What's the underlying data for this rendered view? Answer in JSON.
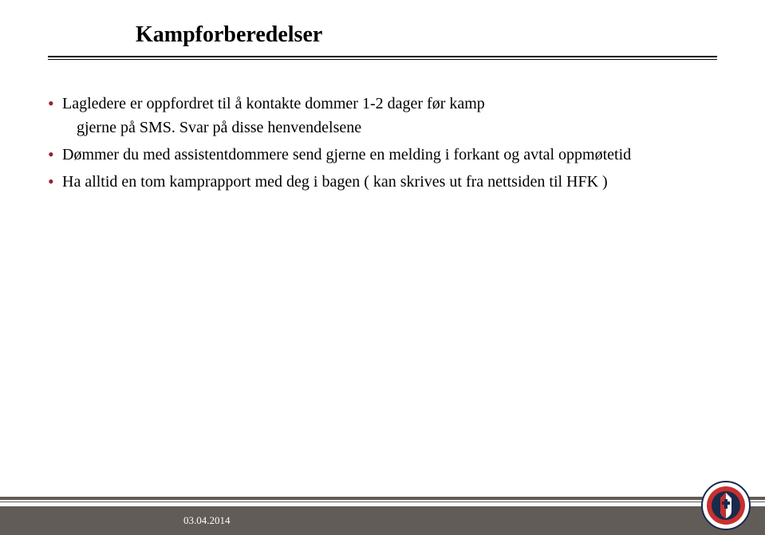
{
  "title": "Kampforberedelser",
  "bullets": [
    {
      "text": "Lagledere er oppfordret til å kontakte dommer 1-2 dager før kamp",
      "sub": "gjerne på SMS. Svar på disse henvendelsene"
    },
    {
      "text": "Dømmer du med assistentdommere send gjerne en melding i forkant og avtal oppmøtetid",
      "sub": null
    },
    {
      "text": "Ha alltid en tom kamprapport med deg i bagen ( kan skrives ut fra nettsiden til HFK )",
      "sub": null
    }
  ],
  "footer": {
    "date": "03.04.2014"
  }
}
